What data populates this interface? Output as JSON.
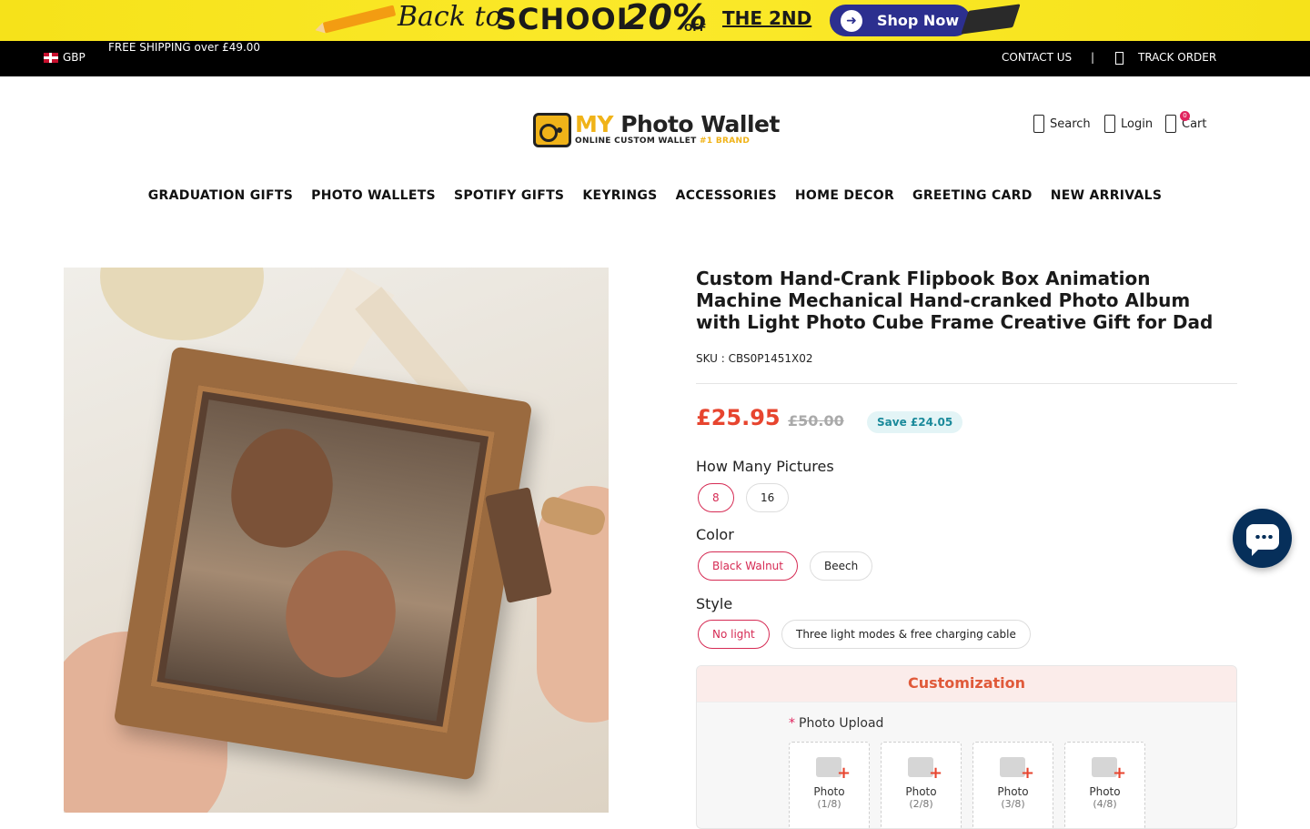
{
  "promo": {
    "back_to": "Back to",
    "school": "SCHOOL",
    "percent": "20%",
    "off": "OFF",
    "the_2nd": "THE 2ND",
    "shop_now": "Shop Now"
  },
  "topbar": {
    "currency": "GBP",
    "free_shipping": "FREE SHIPPING over £49.00",
    "contact": "CONTACT US",
    "separator": "|",
    "track_order": "TRACK ORDER"
  },
  "header": {
    "logo_my": "MY",
    "logo_name": " Photo Wallet",
    "logo_sub_1": "ONLINE CUSTOM WALLET ",
    "logo_sub_2": "#1 BRAND",
    "search": "Search",
    "login": "Login",
    "cart": "Cart",
    "cart_count": "0"
  },
  "nav": [
    "GRADUATION GIFTS",
    "PHOTO WALLETS",
    "SPOTIFY GIFTS",
    "KEYRINGS",
    "ACCESSORIES",
    "HOME DECOR",
    "GREETING CARD",
    "NEW ARRIVALS"
  ],
  "product": {
    "title": "Custom Hand-Crank Flipbook Box Animation Machine Mechanical Hand-cranked Photo Album with Light Photo Cube Frame Creative Gift for Dad",
    "sku": "SKU : CBS0P1451X02",
    "price": "£25.95",
    "old_price": "£50.00",
    "save": "Save £24.05",
    "options": {
      "pictures_label": "How Many Pictures",
      "pictures": [
        "8",
        "16"
      ],
      "color_label": "Color",
      "colors": [
        "Black Walnut",
        "Beech"
      ],
      "style_label": "Style",
      "styles": [
        "No light",
        "Three light modes & free charging cable"
      ]
    }
  },
  "customization": {
    "heading": "Customization",
    "required_mark": "*",
    "upload_label": "Photo Upload",
    "slots": [
      {
        "label": "Photo",
        "index": "(1/8)"
      },
      {
        "label": "Photo",
        "index": "(2/8)"
      },
      {
        "label": "Photo",
        "index": "(3/8)"
      },
      {
        "label": "Photo",
        "index": "(4/8)"
      }
    ]
  },
  "colors": {
    "accent_red": "#e7452f",
    "selected_chip": "#d62b54",
    "chat_bg": "#062f5a",
    "promo_bg": "#f6e21a"
  }
}
